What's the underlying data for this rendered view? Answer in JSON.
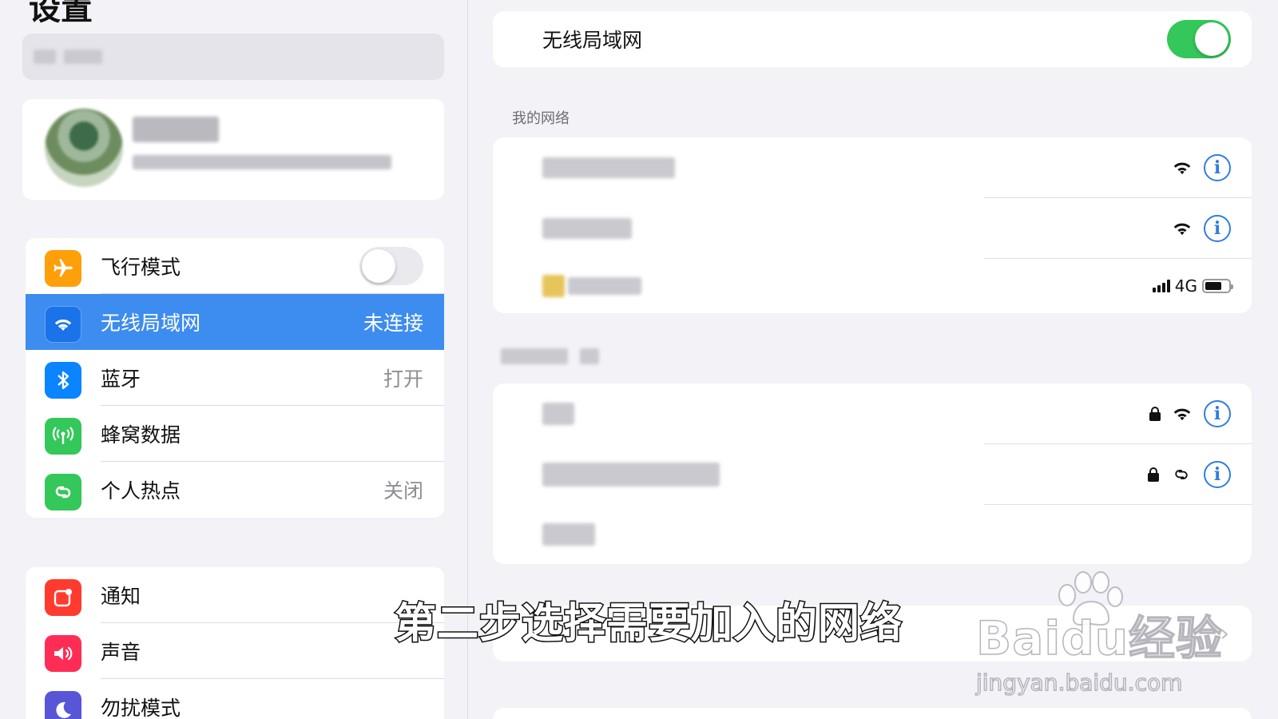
{
  "sidebar": {
    "title": "设置",
    "group1": [
      {
        "label": "飞行模式",
        "value": "",
        "icon": "airplane-icon",
        "color": "#ff9f0a",
        "toggle": "off"
      },
      {
        "label": "无线局域网",
        "value": "未连接",
        "icon": "wifi-icon",
        "color": "#1a73e8",
        "selected": true
      },
      {
        "label": "蓝牙",
        "value": "打开",
        "icon": "bluetooth-icon",
        "color": "#0a84ff"
      },
      {
        "label": "蜂窝数据",
        "value": "",
        "icon": "cellular-icon",
        "color": "#34c759"
      },
      {
        "label": "个人热点",
        "value": "关闭",
        "icon": "hotspot-icon",
        "color": "#34c759"
      }
    ],
    "group2": [
      {
        "label": "通知",
        "icon": "notifications-icon",
        "color": "#ff3b30"
      },
      {
        "label": "声音",
        "icon": "sound-icon",
        "color": "#ff2d55"
      },
      {
        "label": "勿扰模式",
        "icon": "moon-icon",
        "color": "#5856d6"
      }
    ]
  },
  "main": {
    "wifi_label": "无线局域网",
    "wifi_toggle": "on",
    "my_networks_header": "我的网络",
    "cell_label": "4G"
  },
  "overlay": {
    "subtitle": "第二步选择需要加入的网络",
    "watermark_brand": "Baidu经验",
    "watermark_url": "jingyan.baidu.com"
  }
}
